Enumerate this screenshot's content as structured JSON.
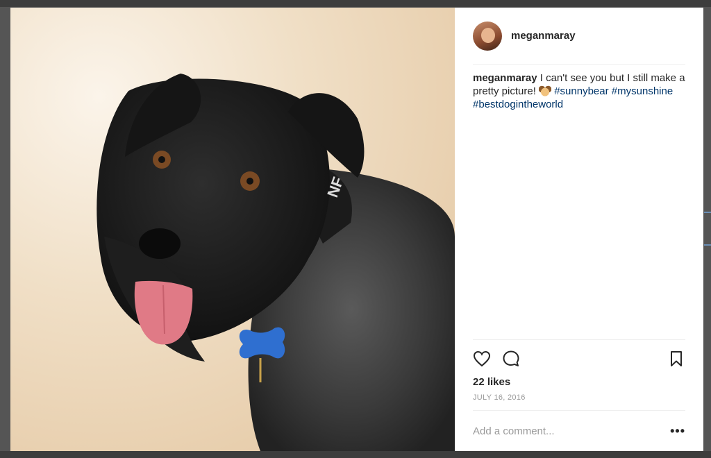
{
  "post": {
    "username": "meganmaray",
    "caption": {
      "user": "meganmaray",
      "text": "I can't see you but I still make a pretty picture!",
      "emoji": "dog-face",
      "hashtags": [
        "#sunnybear",
        "#mysunshine",
        "#bestdogintheworld"
      ]
    },
    "likes": "22 likes",
    "date": "JULY 16, 2016",
    "comment_placeholder": "Add a comment...",
    "more_label": "•••"
  },
  "icons": {
    "like": "heart-icon",
    "comment": "speech-bubble-icon",
    "save": "bookmark-icon",
    "options": "more-options-icon"
  },
  "colors": {
    "hashtag": "#003569",
    "text": "#262626",
    "muted": "#999999"
  }
}
